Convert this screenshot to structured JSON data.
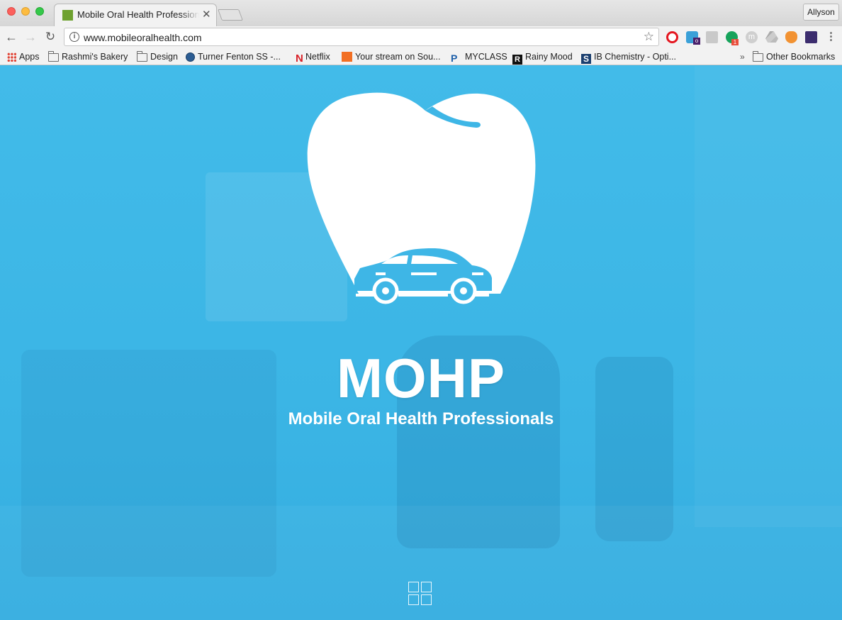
{
  "browser": {
    "tab": {
      "title": "Mobile Oral Health Professionals",
      "close_glyph": "✕"
    },
    "profile_name": "Allyson",
    "nav": {
      "back_glyph": "←",
      "forward_glyph": "→",
      "reload_glyph": "↻"
    },
    "address_bar": {
      "url": "www.mobileoralhealth.com",
      "info_glyph": "i",
      "star_glyph": "☆"
    },
    "extensions": [
      {
        "name": "opera-vpn-icon"
      },
      {
        "name": "hootsuite-icon",
        "badge": "o"
      },
      {
        "name": "photo-extension-icon"
      },
      {
        "name": "grammarly-icon",
        "badge": "1"
      },
      {
        "name": "m-extension-icon",
        "letter": "m"
      },
      {
        "name": "google-drive-icon"
      },
      {
        "name": "fox-extension-icon"
      },
      {
        "name": "night-extension-icon"
      }
    ],
    "menu_glyph": "⋮",
    "bookmarks": {
      "apps": "Apps",
      "rashmi": "Rashmi's Bakery",
      "design": "Design",
      "turner": "Turner Fenton SS -...",
      "netflix": "Netflix",
      "soundcloud": "Your stream on Sou...",
      "myclass": "MYCLASS",
      "rainy": "Rainy Mood",
      "ib": "IB Chemistry - Opti...",
      "overflow": "»",
      "other": "Other Bookmarks"
    },
    "bookmark_icon_letters": {
      "netflix": "N",
      "myclass": "P",
      "rainy": "R",
      "ib": "S"
    }
  },
  "page": {
    "title": "MOHP",
    "subtitle": "Mobile Oral Health Professionals",
    "colors": {
      "hero_blue": "#3eb6e6",
      "logo_white": "#ffffff",
      "car_blue": "#3eb6e6"
    }
  }
}
